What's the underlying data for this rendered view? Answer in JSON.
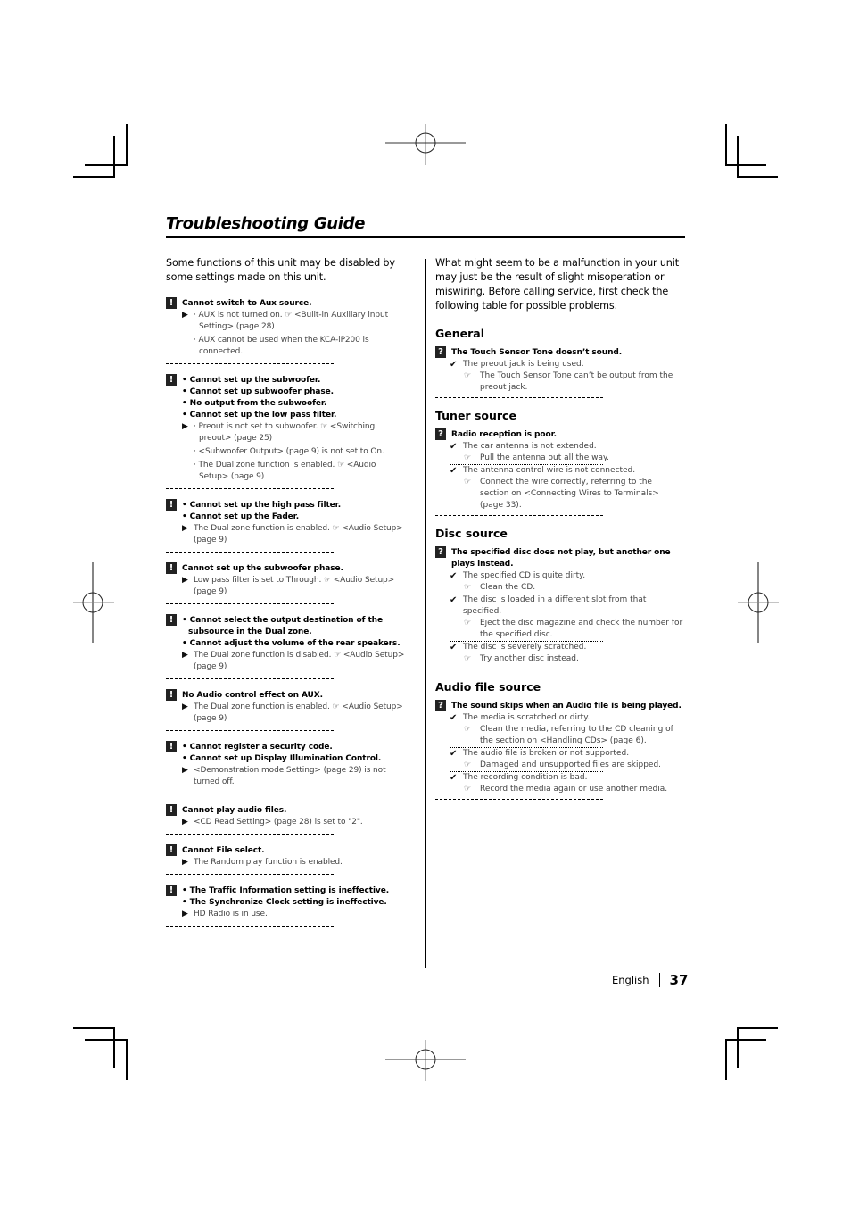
{
  "page": {
    "title": "Troubleshooting Guide",
    "language": "English",
    "page_number": "37"
  },
  "left": {
    "intro": "Some functions of this unit may be disabled by some settings made on this unit.",
    "icon": "!",
    "blocks": [
      {
        "problems": [
          "Cannot switch to Aux source."
        ],
        "bulleted": false,
        "solutions": [
          "AUX is not turned on. ☞ <Built-in Auxiliary input Setting> (page 28)",
          "AUX cannot be used when the KCA-iP200 is connected."
        ],
        "sol_bulleted": true
      },
      {
        "problems": [
          "Cannot set up the subwoofer.",
          "Cannot set up subwoofer phase.",
          "No output from the subwoofer.",
          "Cannot set up the low pass filter."
        ],
        "bulleted": true,
        "solutions": [
          "Preout is not set to subwoofer. ☞ <Switching preout> (page 25)",
          "<Subwoofer Output> (page 9) is not set to On.",
          "The Dual zone function is enabled. ☞ <Audio Setup> (page 9)"
        ],
        "sol_bulleted": true
      },
      {
        "problems": [
          "Cannot set up the high pass filter.",
          "Cannot set up the Fader."
        ],
        "bulleted": true,
        "solutions": [
          "The Dual zone function is enabled. ☞ <Audio Setup> (page 9)"
        ],
        "sol_bulleted": false
      },
      {
        "problems": [
          "Cannot set up the subwoofer phase."
        ],
        "bulleted": false,
        "solutions": [
          "Low pass filter is set to Through. ☞ <Audio Setup> (page 9)"
        ],
        "sol_bulleted": false
      },
      {
        "problems": [
          "Cannot select the output destination of the subsource in the Dual zone.",
          "Cannot adjust the volume of the rear speakers."
        ],
        "bulleted": true,
        "solutions": [
          "The Dual zone function is disabled. ☞ <Audio Setup> (page 9)"
        ],
        "sol_bulleted": false
      },
      {
        "problems": [
          "No Audio control effect on AUX."
        ],
        "bulleted": false,
        "solutions": [
          "The Dual zone function is enabled. ☞ <Audio Setup> (page 9)"
        ],
        "sol_bulleted": false
      },
      {
        "problems": [
          "Cannot register a security code.",
          "Cannot set up Display Illumination Control."
        ],
        "bulleted": true,
        "solutions": [
          "<Demonstration mode Setting> (page 29) is not turned off."
        ],
        "sol_bulleted": false
      },
      {
        "problems": [
          "Cannot play audio files."
        ],
        "bulleted": false,
        "solutions": [
          "<CD Read Setting> (page 28) is set to \"2\"."
        ],
        "sol_bulleted": false
      },
      {
        "problems": [
          "Cannot File select."
        ],
        "bulleted": false,
        "solutions": [
          "The Random play function is enabled."
        ],
        "sol_bulleted": false
      },
      {
        "problems": [
          "The Traffic Information setting is ineffective.",
          "The Synchronize Clock setting is ineffective."
        ],
        "bulleted": true,
        "solutions": [
          "HD Radio is in use."
        ],
        "sol_bulleted": false
      }
    ]
  },
  "right": {
    "intro": "What might seem to be a malfunction in your unit may just be the result of slight misoperation or miswiring. Before calling service, first check the following table for possible problems.",
    "icon": "?",
    "sections": [
      {
        "heading": "General",
        "problem": "The Touch Sensor Tone doesn’t sound.",
        "causes": [
          {
            "cause": "The preout jack is being used.",
            "fix": "The Touch Sensor Tone can’t be output from the preout jack."
          }
        ]
      },
      {
        "heading": "Tuner source",
        "problem": "Radio reception is poor.",
        "causes": [
          {
            "cause": "The car antenna is not extended.",
            "fix": "Pull the antenna out all the way."
          },
          {
            "cause": "The antenna control wire is not connected.",
            "fix": "Connect the wire correctly, referring to the section on <Connecting Wires to Terminals> (page 33)."
          }
        ]
      },
      {
        "heading": "Disc source",
        "problem": "The specified disc does not play, but another one plays instead.",
        "causes": [
          {
            "cause": "The specified CD is quite dirty.",
            "fix": "Clean the CD."
          },
          {
            "cause": "The disc is loaded in a different slot from that specified.",
            "fix": "Eject the disc magazine and check the number for the specified disc."
          },
          {
            "cause": "The disc is severely scratched.",
            "fix": "Try another disc instead."
          }
        ]
      },
      {
        "heading": "Audio file source",
        "problem": "The sound skips when an Audio file is being played.",
        "causes": [
          {
            "cause": "The media is scratched or dirty.",
            "fix": "Clean the media, referring to the CD cleaning of the section on <Handling CDs> (page 6)."
          },
          {
            "cause": "The audio file is broken or not supported.",
            "fix": "Damaged and unsupported files are skipped."
          },
          {
            "cause": "The recording condition is bad.",
            "fix": "Record the media again or use another media."
          }
        ]
      }
    ]
  },
  "glyphs": {
    "arrow": "▶",
    "check": "✔",
    "hand": "☞",
    "bullet": "•"
  }
}
